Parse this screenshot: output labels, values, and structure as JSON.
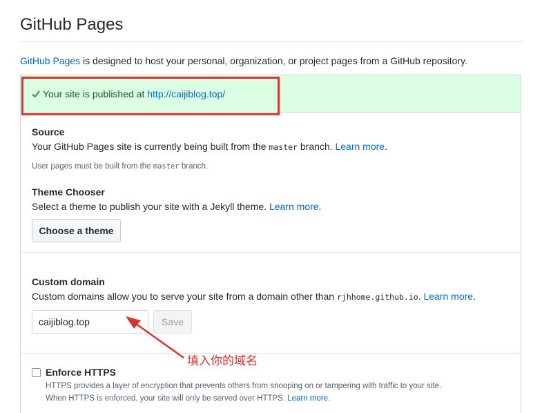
{
  "page": {
    "title": "GitHub Pages",
    "intro_link": "GitHub Pages",
    "intro_text": " is designed to host your personal, organization, or project pages from a GitHub repository."
  },
  "flash": {
    "text": "Your site is published at ",
    "url": "http://caijiblog.top/"
  },
  "source": {
    "label": "Source",
    "text_before": "Your GitHub Pages site is currently being built from the ",
    "branch": "master",
    "text_after": " branch. ",
    "learn_more": "Learn more",
    "note_before": "User pages must be built from the ",
    "note_branch": "master",
    "note_after": " branch."
  },
  "theme": {
    "label": "Theme Chooser",
    "text": "Select a theme to publish your site with a Jekyll theme. ",
    "learn_more": "Learn more",
    "button": "Choose a theme"
  },
  "custom_domain": {
    "label": "Custom domain",
    "text_before": "Custom domains allow you to serve your site from a domain other than ",
    "domain": "rjhhome.github.io",
    "text_after": ". ",
    "learn_more": "Learn more",
    "input_value": "caijiblog.top",
    "save_button": "Save"
  },
  "https": {
    "label": "Enforce HTTPS",
    "line1": "HTTPS provides a layer of encryption that prevents others from snooping on or tampering with traffic to your site.",
    "line2": "When HTTPS is enforced, your site will only be served over HTTPS. ",
    "learn_more": "Learn more",
    "checked": false
  },
  "annotation": {
    "text": "填入你的域名",
    "color": "#e03131"
  },
  "colors": {
    "link": "#0366d6",
    "flash_bg": "#dcffe4",
    "highlight": "#e03131"
  }
}
